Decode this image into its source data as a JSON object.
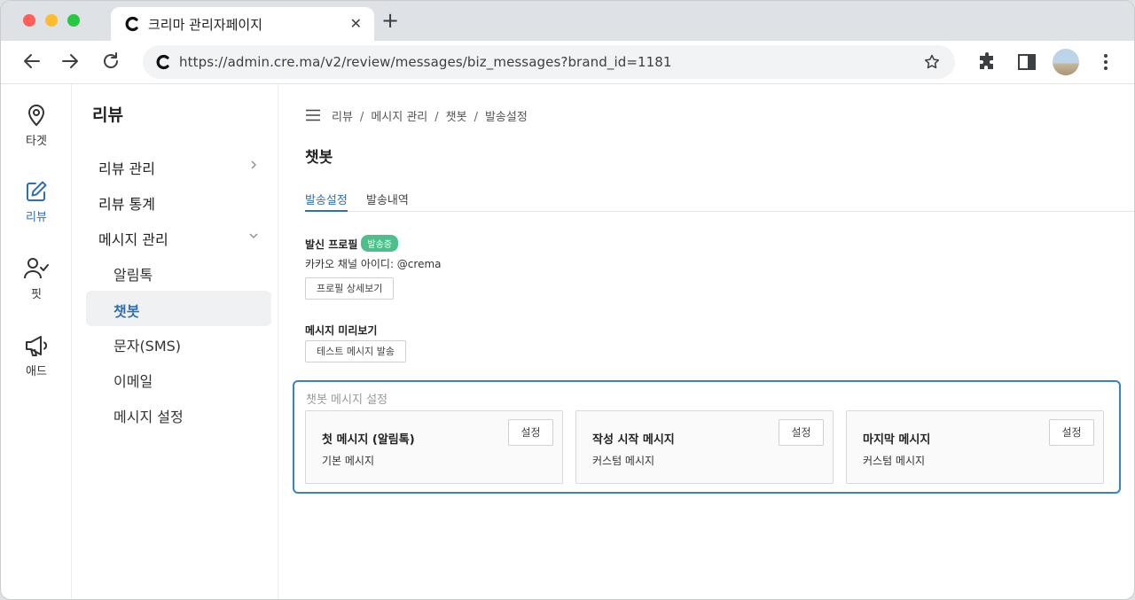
{
  "browser": {
    "tab_title": "크리마 관리자페이지",
    "tab_close": "✕",
    "new_tab": "+",
    "url": "https://admin.cre.ma/v2/review/messages/biz_messages?brand_id=1181"
  },
  "rail": {
    "items": [
      {
        "label": "타겟",
        "icon": "location-pin-icon"
      },
      {
        "label": "리뷰",
        "icon": "edit-icon"
      },
      {
        "label": "핏",
        "icon": "user-check-icon"
      },
      {
        "label": "애드",
        "icon": "megaphone-icon"
      }
    ]
  },
  "sidebar": {
    "title": "리뷰",
    "items": [
      {
        "label": "리뷰 관리"
      },
      {
        "label": "리뷰 통계"
      },
      {
        "label": "메시지 관리"
      },
      {
        "label": "알림톡"
      },
      {
        "label": "챗봇"
      },
      {
        "label": "문자(SMS)"
      },
      {
        "label": "이메일"
      },
      {
        "label": "메시지 설정"
      }
    ]
  },
  "main": {
    "breadcrumb": [
      "리뷰",
      "메시지 관리",
      "챗봇",
      "발송설정"
    ],
    "breadcrumb_sep": "/",
    "title": "챗봇",
    "tabs": [
      {
        "label": "발송설정"
      },
      {
        "label": "발송내역"
      }
    ],
    "profile": {
      "label": "발신 프로필",
      "badge": "발송중",
      "channel_info": "카카오 채널 아이디: @crema",
      "detail_button": "프로필 상세보기"
    },
    "preview": {
      "label": "메시지 미리보기",
      "test_button": "테스트 메시지 발송"
    },
    "chatbot_settings": {
      "title": "챗봇 메시지 설정",
      "cards": [
        {
          "title": "첫 메시지 (알림톡)",
          "value": "기본 메시지",
          "button": "설정"
        },
        {
          "title": "작성 시작 메시지",
          "value": "커스텀 메시지",
          "button": "설정"
        },
        {
          "title": "마지막 메시지",
          "value": "커스텀 메시지",
          "button": "설정"
        }
      ]
    }
  },
  "colors": {
    "accent": "#2f6fb8",
    "badge": "#4dbf8a",
    "highlight_border": "#3b82c4"
  }
}
